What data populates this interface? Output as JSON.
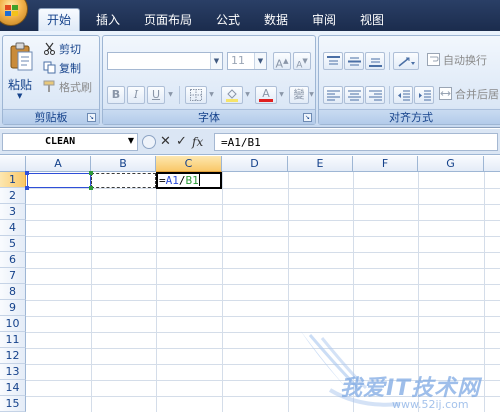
{
  "tabs": [
    {
      "label": "开始",
      "active": true
    },
    {
      "label": "插入"
    },
    {
      "label": "页面布局"
    },
    {
      "label": "公式"
    },
    {
      "label": "数据"
    },
    {
      "label": "审阅"
    },
    {
      "label": "视图"
    }
  ],
  "clipboard": {
    "paste": "粘贴",
    "cut": "剪切",
    "copy": "复制",
    "format_painter": "格式刷",
    "group_label": "剪贴板"
  },
  "font": {
    "size": "11",
    "group_label": "字体",
    "bold": "B",
    "italic": "I",
    "underline": "U",
    "font_color_glyph": "A",
    "grow_glyph": "A",
    "shrink_glyph": "A",
    "phonetic_glyph": "變"
  },
  "alignment": {
    "wrap_text": "自动换行",
    "merge_center": "合并后居",
    "group_label": "对齐方式"
  },
  "formula_bar": {
    "name_box": "CLEAN",
    "cancel_glyph": "✕",
    "enter_glyph": "✓",
    "fx_label": "fx",
    "formula": "=A1/B1"
  },
  "columns": [
    "A",
    "B",
    "C",
    "D",
    "E",
    "F",
    "G"
  ],
  "rows": [
    "1",
    "2",
    "3",
    "4",
    "5",
    "6",
    "7",
    "8",
    "9",
    "10",
    "11",
    "12",
    "13",
    "14",
    "15"
  ],
  "cell_c1": {
    "eq": "=",
    "ref1": "A1",
    "op": "/",
    "ref2": "B1"
  },
  "watermark": {
    "title": "我爱IT技术网",
    "url": "www.52ij.com"
  },
  "colors": {
    "ref1": "#2f4fd8",
    "ref2": "#2f9a3a",
    "selected_header": "#f9c869"
  }
}
